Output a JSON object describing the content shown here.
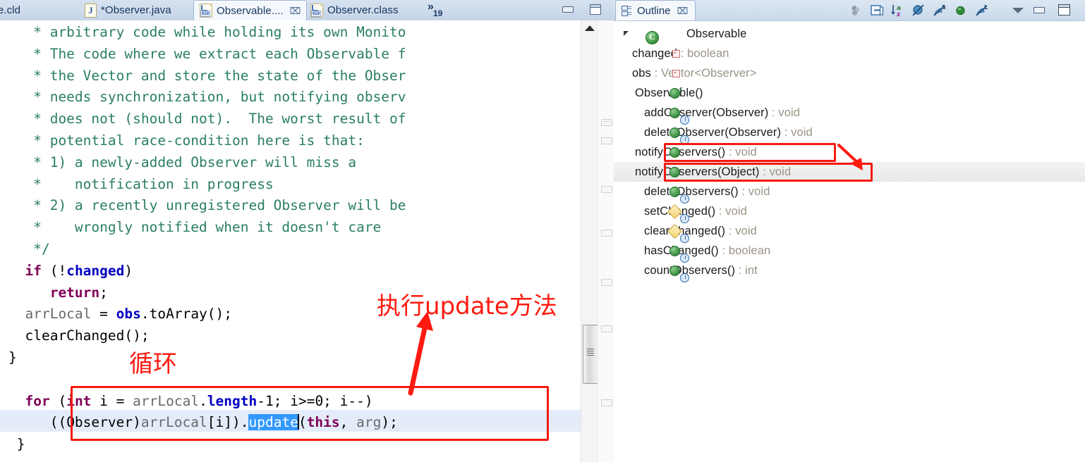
{
  "editor": {
    "tabs": [
      {
        "label": "ile.cld",
        "icon": "none",
        "active": false,
        "closeable": false
      },
      {
        "label": "*Observer.java",
        "icon": "java-file-icon",
        "active": false,
        "closeable": false
      },
      {
        "label": "Observable....",
        "icon": "class-file-icon",
        "active": true,
        "closeable": true,
        "close_glyph": "⌧"
      },
      {
        "label": "Observer.class",
        "icon": "class-file-icon",
        "active": false,
        "closeable": false
      }
    ],
    "overflow": {
      "chevron": "»",
      "count": "19"
    },
    "window_buttons": [
      {
        "name": "minimize-button",
        "glyph": "minimize"
      },
      {
        "name": "maximize-button",
        "glyph": "maximize"
      }
    ],
    "code_lines": [
      [
        {
          "t": "   * arbitrary code while holding its own Monito",
          "c": "cm"
        }
      ],
      [
        {
          "t": "   * The code where we extract each Observable f",
          "c": "cm"
        }
      ],
      [
        {
          "t": "   * the Vector and store the state of the Obser",
          "c": "cm"
        }
      ],
      [
        {
          "t": "   * needs synchronization, but notifying observ",
          "c": "cm"
        }
      ],
      [
        {
          "t": "   * does not (should not).  The worst result of",
          "c": "cm"
        }
      ],
      [
        {
          "t": "   * potential race-condition here is that:",
          "c": "cm"
        }
      ],
      [
        {
          "t": "   * 1) a newly-added Observer will miss a",
          "c": "cm"
        }
      ],
      [
        {
          "t": "   *    notification in progress",
          "c": "cm"
        }
      ],
      [
        {
          "t": "   * 2) a recently unregistered Observer will be",
          "c": "cm"
        }
      ],
      [
        {
          "t": "   *    wrongly notified when it doesn't care",
          "c": "cm"
        }
      ],
      [
        {
          "t": "   */",
          "c": "cm"
        }
      ],
      [
        {
          "t": "  ",
          "c": "pl"
        },
        {
          "t": "if",
          "c": "kw"
        },
        {
          "t": " (!",
          "c": "pl"
        },
        {
          "t": "changed",
          "c": "fld"
        },
        {
          "t": ")",
          "c": "pl"
        }
      ],
      [
        {
          "t": "     ",
          "c": "pl"
        },
        {
          "t": "return",
          "c": "kw"
        },
        {
          "t": ";",
          "c": "pl"
        }
      ],
      [
        {
          "t": "  ",
          "c": "pl"
        },
        {
          "t": "arrLocal",
          "c": "lv"
        },
        {
          "t": " = ",
          "c": "pl"
        },
        {
          "t": "obs",
          "c": "fld"
        },
        {
          "t": ".toArray();",
          "c": "pl"
        }
      ],
      [
        {
          "t": "  clearChanged();",
          "c": "pl"
        }
      ],
      [
        {
          "t": "}",
          "c": "pl"
        }
      ],
      [],
      [
        {
          "t": "  ",
          "c": "pl"
        },
        {
          "t": "for",
          "c": "kw"
        },
        {
          "t": " (",
          "c": "pl"
        },
        {
          "t": "int",
          "c": "kw"
        },
        {
          "t": " i = ",
          "c": "pl"
        },
        {
          "t": "arrLocal",
          "c": "lv"
        },
        {
          "t": ".",
          "c": "pl"
        },
        {
          "t": "length",
          "c": "fld"
        },
        {
          "t": "-1; i>=0; i--)",
          "c": "pl"
        }
      ],
      [
        {
          "t": "     ((",
          "c": "pl"
        },
        {
          "t": "Observer",
          "c": "pl"
        },
        {
          "t": ")",
          "c": "pl"
        },
        {
          "t": "arrLocal",
          "c": "lv"
        },
        {
          "t": "[i]).",
          "c": "pl"
        },
        {
          "t": "update",
          "c": "sel"
        },
        {
          "t": "(",
          "c": "pl"
        },
        {
          "t": "this",
          "c": "kw"
        },
        {
          "t": ", ",
          "c": "pl"
        },
        {
          "t": "arg",
          "c": "lv"
        },
        {
          "t": ");",
          "c": "pl"
        }
      ],
      [
        {
          "t": " }",
          "c": "pl"
        }
      ]
    ],
    "selected_token": "update",
    "scrollbar": {
      "name": "editor-vertical-scrollbar"
    }
  },
  "outline": {
    "title": "Outline",
    "close_glyph": "⌧",
    "toolbar": [
      {
        "name": "focus-on-active-task-button"
      },
      {
        "name": "collapse-all-button"
      },
      {
        "name": "sort-button"
      },
      {
        "name": "hide-fields-button"
      },
      {
        "name": "hide-static-members-button"
      },
      {
        "name": "hide-non-public-members-button"
      },
      {
        "name": "hide-local-types-button"
      }
    ],
    "window_buttons": [
      {
        "name": "view-menu-button",
        "glyph": "chevron-down"
      },
      {
        "name": "minimize-button",
        "glyph": "minimize"
      },
      {
        "name": "maximize-button",
        "glyph": "maximize"
      }
    ],
    "root": {
      "label": "Observable",
      "icon": "class-icon",
      "expanded": true
    },
    "items": [
      {
        "label": "changed",
        "type": " : boolean",
        "icon": "private-field-icon",
        "indent": 0,
        "overridden": false,
        "highlighted": false,
        "selected": false
      },
      {
        "label": "obs",
        "type": " : Vector<Observer>",
        "icon": "private-field-icon",
        "indent": 0,
        "overridden": false,
        "highlighted": false,
        "selected": false
      },
      {
        "label": "Observable()",
        "type": "",
        "icon": "public-constructor-icon",
        "indent": 0,
        "overridden": false,
        "highlighted": false,
        "selected": false
      },
      {
        "label": "addObserver(Observer)",
        "type": " : void",
        "icon": "public-method-icon",
        "indent": 0,
        "overridden": true,
        "highlighted": false,
        "selected": false
      },
      {
        "label": "deleteObserver(Observer)",
        "type": " : void",
        "icon": "public-method-icon",
        "indent": 0,
        "overridden": true,
        "highlighted": false,
        "selected": false
      },
      {
        "label": "notifyObservers()",
        "type": " : void",
        "icon": "public-method-icon",
        "indent": 0,
        "overridden": false,
        "highlighted": true,
        "selected": false
      },
      {
        "label": "notifyObservers(Object)",
        "type": " : void",
        "icon": "public-method-icon",
        "indent": 0,
        "overridden": false,
        "highlighted": true,
        "selected": true
      },
      {
        "label": "deleteObservers()",
        "type": " : void",
        "icon": "public-method-icon",
        "indent": 0,
        "overridden": true,
        "highlighted": false,
        "selected": false
      },
      {
        "label": "setChanged()",
        "type": " : void",
        "icon": "protected-method-icon",
        "indent": 0,
        "overridden": true,
        "highlighted": false,
        "selected": false
      },
      {
        "label": "clearChanged()",
        "type": " : void",
        "icon": "protected-method-icon",
        "indent": 0,
        "overridden": true,
        "highlighted": false,
        "selected": false
      },
      {
        "label": "hasChanged()",
        "type": " : boolean",
        "icon": "public-method-icon",
        "indent": 0,
        "overridden": true,
        "highlighted": false,
        "selected": false
      },
      {
        "label": "countObservers()",
        "type": " : int",
        "icon": "public-method-icon",
        "indent": 0,
        "overridden": true,
        "highlighted": false,
        "selected": false
      }
    ]
  },
  "annotations": {
    "color": "#ff1a10",
    "update_label": "执行update方法",
    "loop_label": "循环"
  }
}
